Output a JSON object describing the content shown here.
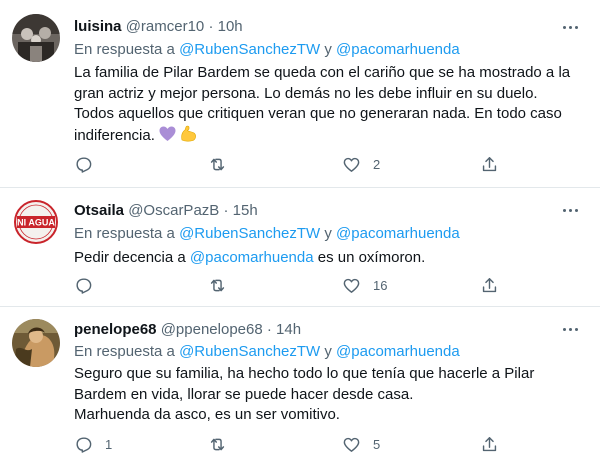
{
  "tweets": [
    {
      "name": "luisina",
      "handle": "@ramcer10",
      "dot": "·",
      "time": "10h",
      "reply_prefix": "En respuesta a",
      "reply_mention_1": "@RubenSanchezTW",
      "reply_and": "y",
      "reply_mention_2": "@pacomarhuenda",
      "text_lines": [
        "La familia de Pilar Bardem se queda con el cariño que se ha mostrado a la",
        "gran actriz y mejor persona. Lo demás no les debe influir en su duelo.",
        "Todos aquellos que critiquen veran que no generaran nada. En todo caso",
        "indiferencia."
      ],
      "emojis": [
        "purple-heart",
        "flexed-biceps"
      ],
      "reply_count": "",
      "retweet_count": "",
      "like_count": "2"
    },
    {
      "name": "Otsaila",
      "handle": "@OscarPazB",
      "dot": "·",
      "time": "15h",
      "reply_prefix": "En respuesta a",
      "reply_mention_1": "@RubenSanchezTW",
      "reply_and": "y",
      "reply_mention_2": "@pacomarhuenda",
      "avatar_text": "NI AGUA",
      "text_prefix": "Pedir decencia a",
      "text_mention": "@pacomarhuenda",
      "text_suffix": " es un oxímoron.",
      "reply_count": "",
      "retweet_count": "",
      "like_count": "16"
    },
    {
      "name": "penelope68",
      "handle": "@ppenelope68",
      "dot": "·",
      "time": "14h",
      "reply_prefix": "En respuesta a",
      "reply_mention_1": "@RubenSanchezTW",
      "reply_and": "y",
      "reply_mention_2": "@pacomarhuenda",
      "text_lines": [
        "Seguro que su familia, ha hecho todo lo que tenía que hacerle a Pilar",
        "Bardem en vida, llorar se puede hacer desde casa.",
        "Marhuenda da asco, es un ser vomitivo."
      ],
      "reply_count": "1",
      "retweet_count": "",
      "like_count": "5"
    }
  ],
  "colors": {
    "link": "#1d9bf0",
    "muted": "#536471",
    "text": "#0f1419",
    "divider": "#e3e8eb"
  },
  "icons": {
    "reply": "reply-icon",
    "retweet": "retweet-icon",
    "like": "heart-icon",
    "share": "share-icon",
    "more": "more-icon"
  }
}
